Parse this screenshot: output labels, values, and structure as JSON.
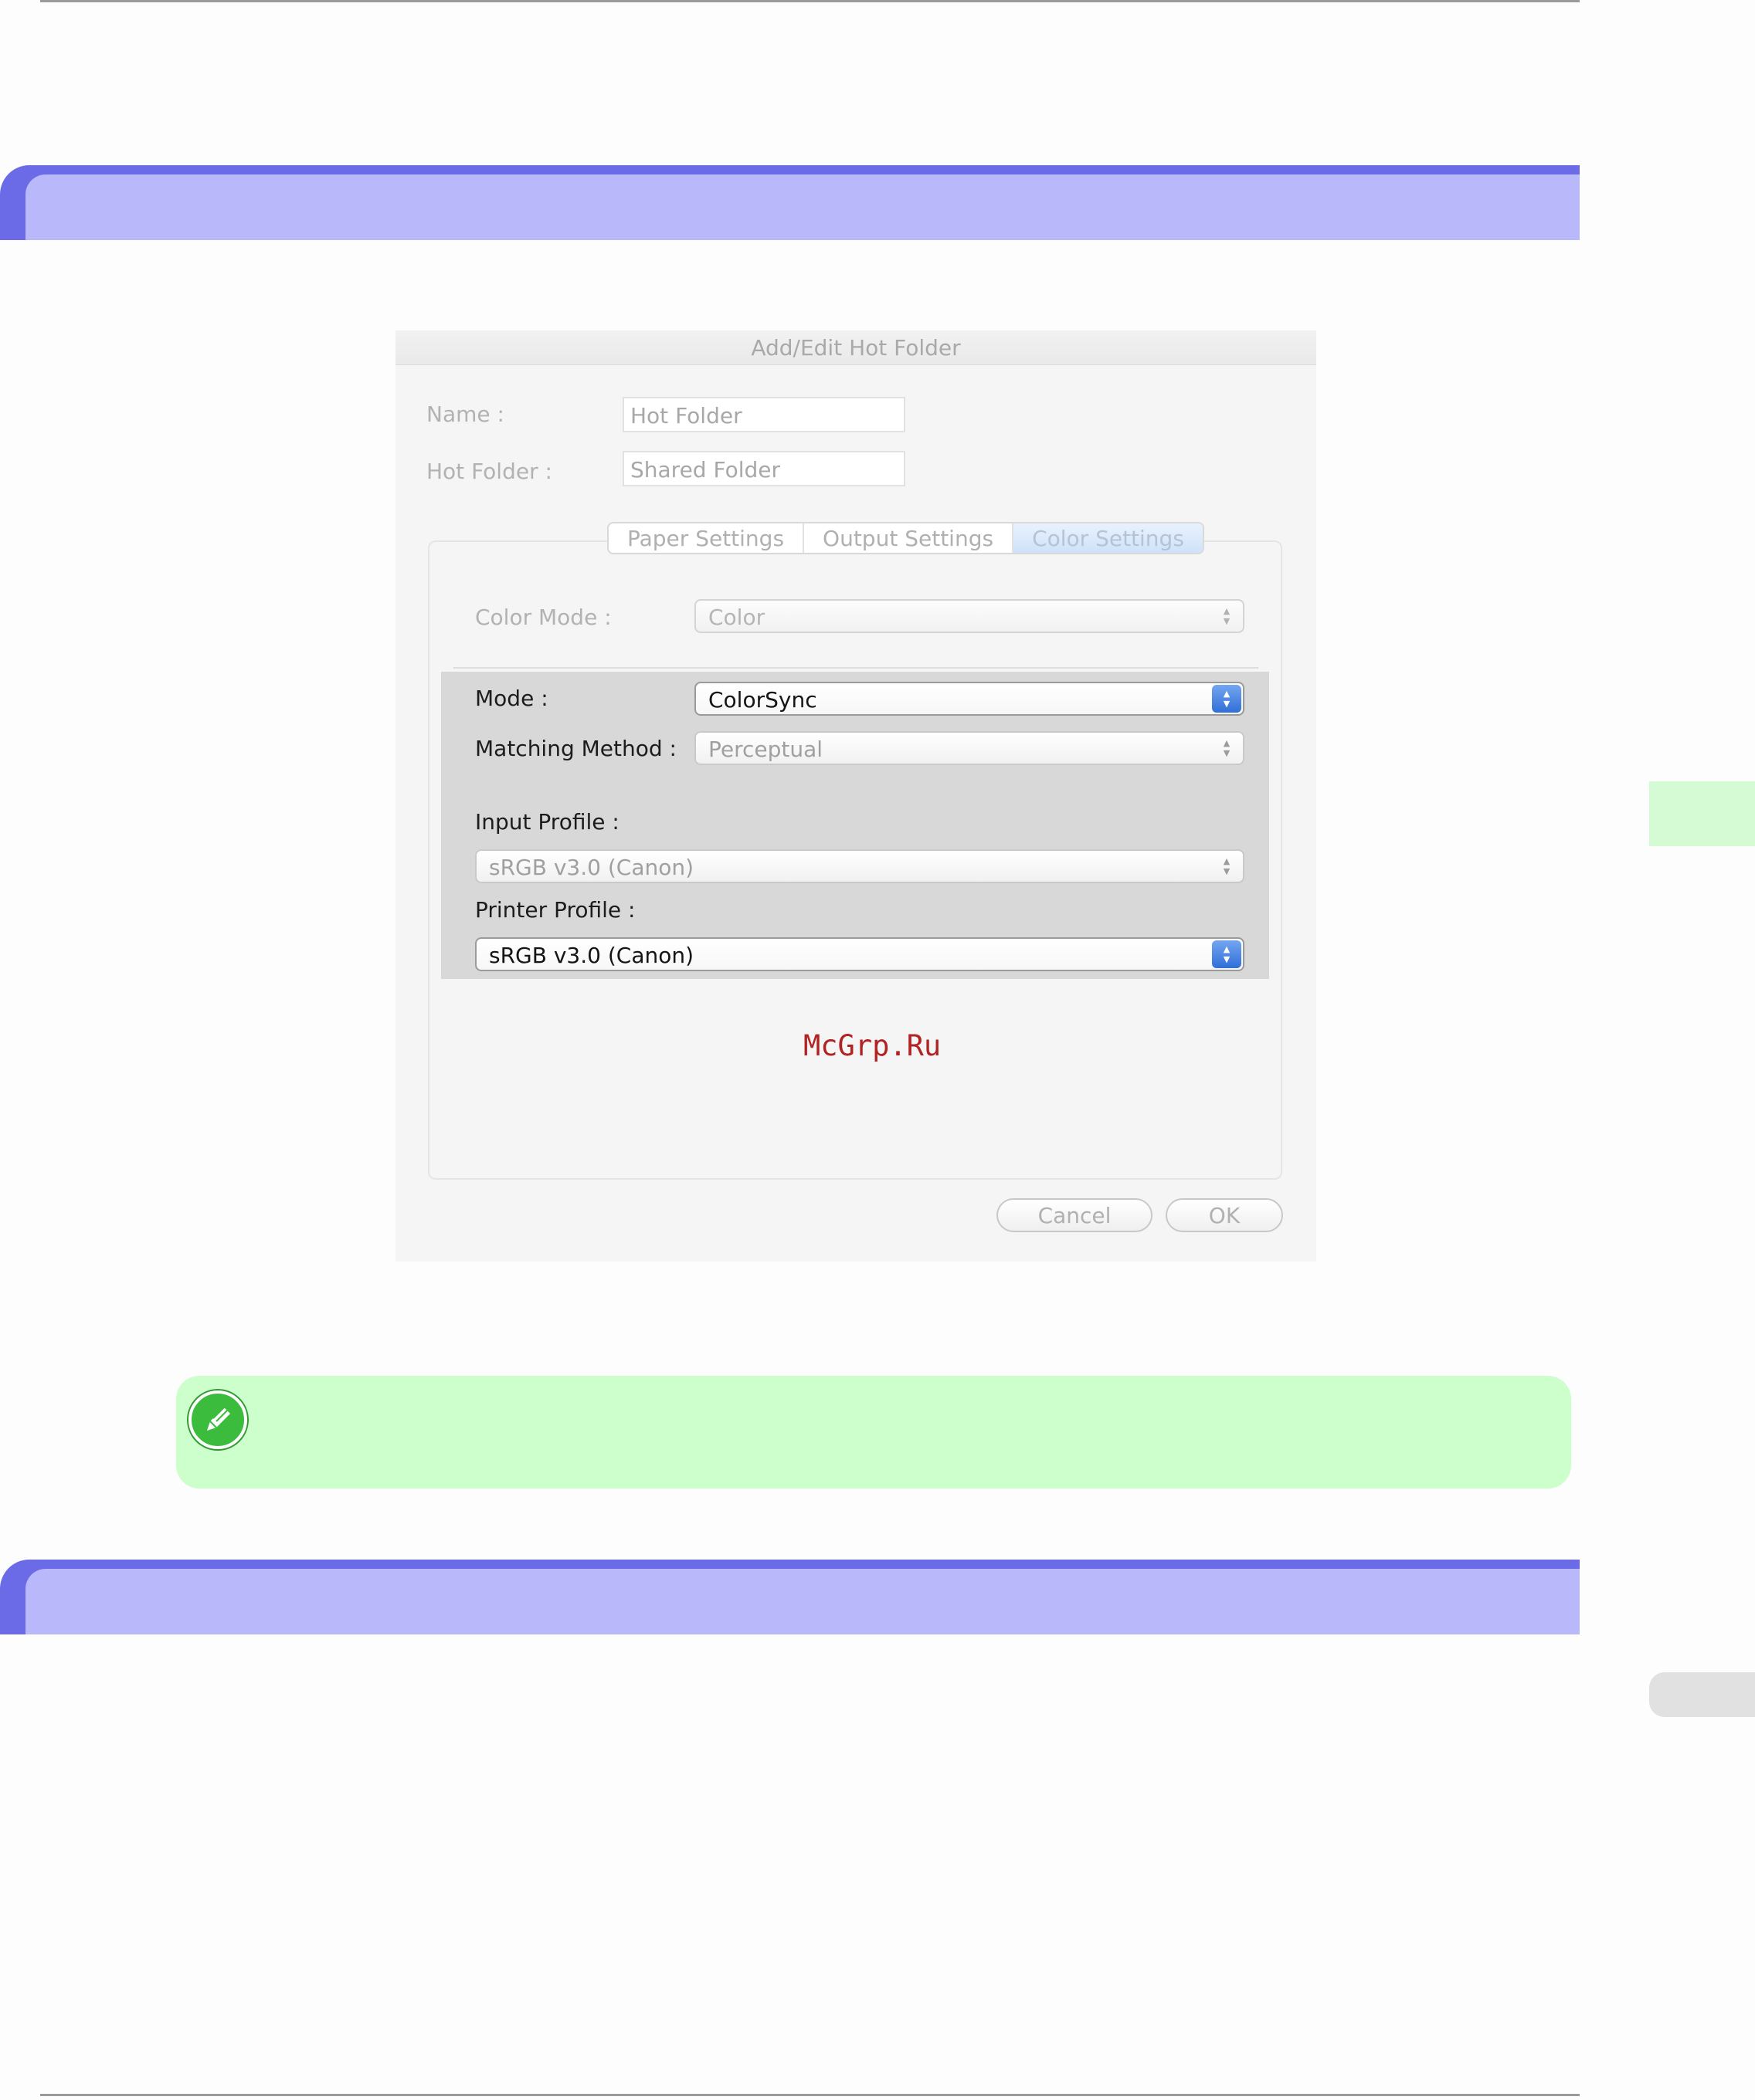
{
  "dialog": {
    "title": "Add/Edit Hot Folder",
    "name_label": "Name :",
    "name_value": "Hot Folder",
    "hot_folder_label": "Hot Folder :",
    "hot_folder_value": "Shared Folder",
    "tabs": [
      {
        "label": "Paper Settings",
        "active": false
      },
      {
        "label": "Output Settings",
        "active": false
      },
      {
        "label": "Color Settings",
        "active": true
      }
    ],
    "color_mode": {
      "label": "Color Mode :",
      "value": "Color"
    },
    "mode": {
      "label": "Mode :",
      "value": "ColorSync"
    },
    "matching_method": {
      "label": "Matching Method :",
      "value": "Perceptual"
    },
    "input_profile": {
      "label": "Input Profile :",
      "value": "sRGB v3.0 (Canon)"
    },
    "printer_profile": {
      "label": "Printer Profile :",
      "value": "sRGB v3.0 (Canon)"
    },
    "cancel_label": "Cancel",
    "ok_label": "OK"
  },
  "watermark": "McGrp.Ru",
  "icons": {
    "note": "pencil-note-icon",
    "popup_arrows": "updown-arrows-icon"
  },
  "colors": {
    "section_bar": "#6b6be8",
    "section_fill": "#b8b8fb",
    "note_bg": "#ccffcc",
    "side_tab": "#d5fbd5",
    "accent_blue": "#2f6fd8"
  }
}
